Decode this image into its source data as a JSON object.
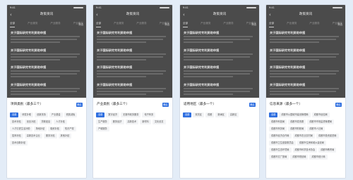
{
  "screens": [
    {
      "time": "9:41",
      "nav_title": "政策资讯",
      "tabs": [
        "全部",
        "产业服务",
        "产业服务",
        "产业服务"
      ],
      "filter_label": "筛选",
      "articles": [
        "关于国际研究专利资助申报",
        "关于国际研究专利资助申报",
        "关于国际研究专利资助申报",
        "关于国际研究专利资助申报"
      ],
      "sheet_title": "项目类别（最多三个）",
      "confirm_label": "确认",
      "chips": [
        "全部",
        "研发补助",
        "创新扶持",
        "产业基金",
        "税费减免",
        "技术补贴",
        "创业补贴",
        "贷款贴息",
        "人才补贴",
        "人才引进生活补助",
        "场地补贴",
        "融资补贴",
        "知识产权",
        "招商补贴",
        "高新技术企业",
        "服务补贴",
        "其他补贴",
        "技术创新补贴"
      ],
      "selected": [
        0
      ]
    },
    {
      "time": "9:41",
      "nav_title": "政策资讯",
      "tabs": [
        "全部",
        "产业服务",
        "产业服务",
        "产业服务"
      ],
      "filter_label": "筛选",
      "articles": [
        "关于国际研究专利资助申报",
        "关于国际研究专利资助申报",
        "关于国际研究专利资助申报",
        "关于国际研究专利资助申报"
      ],
      "sheet_title": "产业类别（最多三个）",
      "confirm_label": "确认",
      "chips": [
        "全部",
        "数字经济",
        "无锡市政务服务",
        "电子商务",
        "生产服务",
        "服务经济",
        "高新技术",
        "新材料",
        "文化创意",
        "产城服务"
      ],
      "selected": [
        0
      ]
    },
    {
      "time": "9:41",
      "nav_title": "政策资讯",
      "tabs": [
        "全部",
        "产业服务",
        "产业服务",
        "产业服务"
      ],
      "filter_label": "筛选",
      "articles": [
        "关于国际研究专利资助申报",
        "关于国际研究专利资助申报",
        "关于国际研究专利资助申报",
        "关于国际研究专利资助申报"
      ],
      "sheet_title": "适用地区（最多一个）",
      "confirm_label": "确认",
      "chips": [
        "全部",
        "双流区",
        "成都",
        "新津区",
        "高新区"
      ],
      "selected": [
        0
      ]
    },
    {
      "time": "9:41",
      "nav_title": "政策资讯",
      "tabs": [
        "全部",
        "产业服务",
        "产业服务",
        "产业服务"
      ],
      "filter_label": "筛选",
      "articles": [
        "关于国际研究专利资助申报",
        "关于国际研究专利资助申报",
        "关于国际研究专利资助申报",
        "关于国际研究专利资助申报"
      ],
      "sheet_title": "信息来源（最多一个）",
      "confirm_label": "确认",
      "chips": [
        "全部",
        "成都市公园城市建设管理局",
        "成都市经信局",
        "成都市科技局",
        "成都市发改委",
        "成都市市场监督管理局",
        "成都市商务局",
        "成都市财政局",
        "成都市人社局",
        "成都市经济合作局",
        "成都市农业农村局",
        "成都市投资促进局",
        "成都市卫生健康委员会",
        "成都市住房和城乡建设局",
        "成都市生态环境局",
        "成都市科学技术协会",
        "成都市教育局",
        "成都市文广旅局",
        "成都市规划局",
        "成都市统计局"
      ],
      "selected": [
        0
      ]
    }
  ]
}
